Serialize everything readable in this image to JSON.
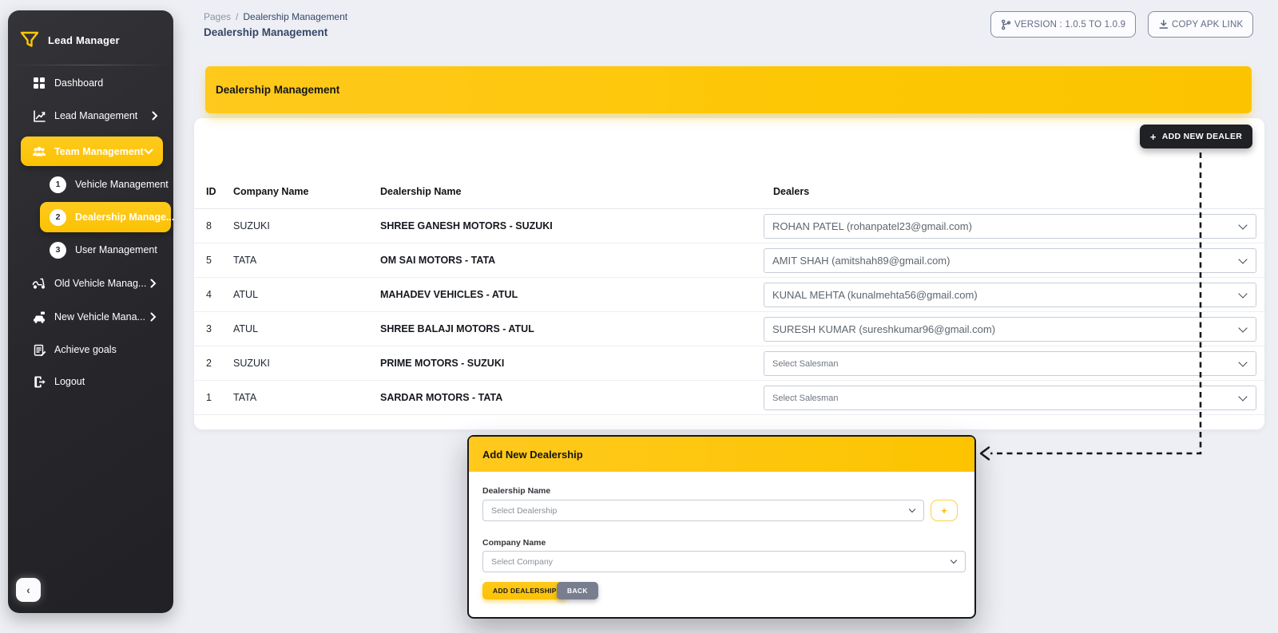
{
  "app": {
    "brand": "Lead Manager"
  },
  "sidebar": {
    "items": [
      {
        "label": "Dashboard"
      },
      {
        "label": "Lead Management"
      },
      {
        "label": "Team Management"
      },
      {
        "num": "1",
        "label": "Vehicle Management"
      },
      {
        "num": "2",
        "label": "Dealership Manage..."
      },
      {
        "num": "3",
        "label": "User Management"
      },
      {
        "label": "Old Vehicle Manag..."
      },
      {
        "label": "New Vehicle Mana..."
      },
      {
        "label": "Achieve goals"
      },
      {
        "label": "Logout"
      }
    ],
    "collapse_icon": "‹"
  },
  "header": {
    "breadcrumb": {
      "root": "Pages",
      "separator": "/",
      "current": "Dealership Management"
    },
    "page_title": "Dealership Management",
    "version_button": "VERSION : 1.0.5 TO 1.0.9",
    "copy_apk_button": "COPY APK LINK"
  },
  "panel": {
    "title": "Dealership Management",
    "add_icon": "+",
    "add_dealer_button": "ADD NEW DEALER"
  },
  "table": {
    "columns": [
      "ID",
      "Company Name",
      "Dealership Name",
      "Dealers"
    ],
    "rows": [
      {
        "id": "8",
        "company": "SUZUKI",
        "dealership": "SHREE GANESH MOTORS - SUZUKI",
        "dealer": "ROHAN PATEL (rohanpatel23@gmail.com)",
        "placeholder": false
      },
      {
        "id": "5",
        "company": "TATA",
        "dealership": "OM SAI MOTORS - TATA",
        "dealer": "AMIT SHAH (amitshah89@gmail.com)",
        "placeholder": false
      },
      {
        "id": "4",
        "company": "ATUL",
        "dealership": "MAHADEV VEHICLES - ATUL",
        "dealer": "KUNAL MEHTA (kunalmehta56@gmail.com)",
        "placeholder": false
      },
      {
        "id": "3",
        "company": "ATUL",
        "dealership": "SHREE BALAJI MOTORS - ATUL",
        "dealer": "SURESH KUMAR (sureshkumar96@gmail.com)",
        "placeholder": false
      },
      {
        "id": "2",
        "company": "SUZUKI",
        "dealership": "PRIME MOTORS - SUZUKI",
        "dealer": "Select Salesman",
        "placeholder": true
      },
      {
        "id": "1",
        "company": "TATA",
        "dealership": "SARDAR MOTORS - TATA",
        "dealer": "Select Salesman",
        "placeholder": true
      }
    ]
  },
  "modal": {
    "title": "Add New Dealership",
    "dealership_label": "Dealership Name",
    "dealership_placeholder": "Select Dealership",
    "add_option_button": "+",
    "company_label": "Company Name",
    "company_placeholder": "Select Company",
    "submit_button": "ADD DEALERSHIP",
    "back_button": "BACK"
  },
  "colors": {
    "accent_yellow": "#fdc704",
    "sidebar_dark": "#2b2b30",
    "dark_button": "#202124",
    "title_navy": "#344767",
    "page_background": "#edeff4"
  }
}
